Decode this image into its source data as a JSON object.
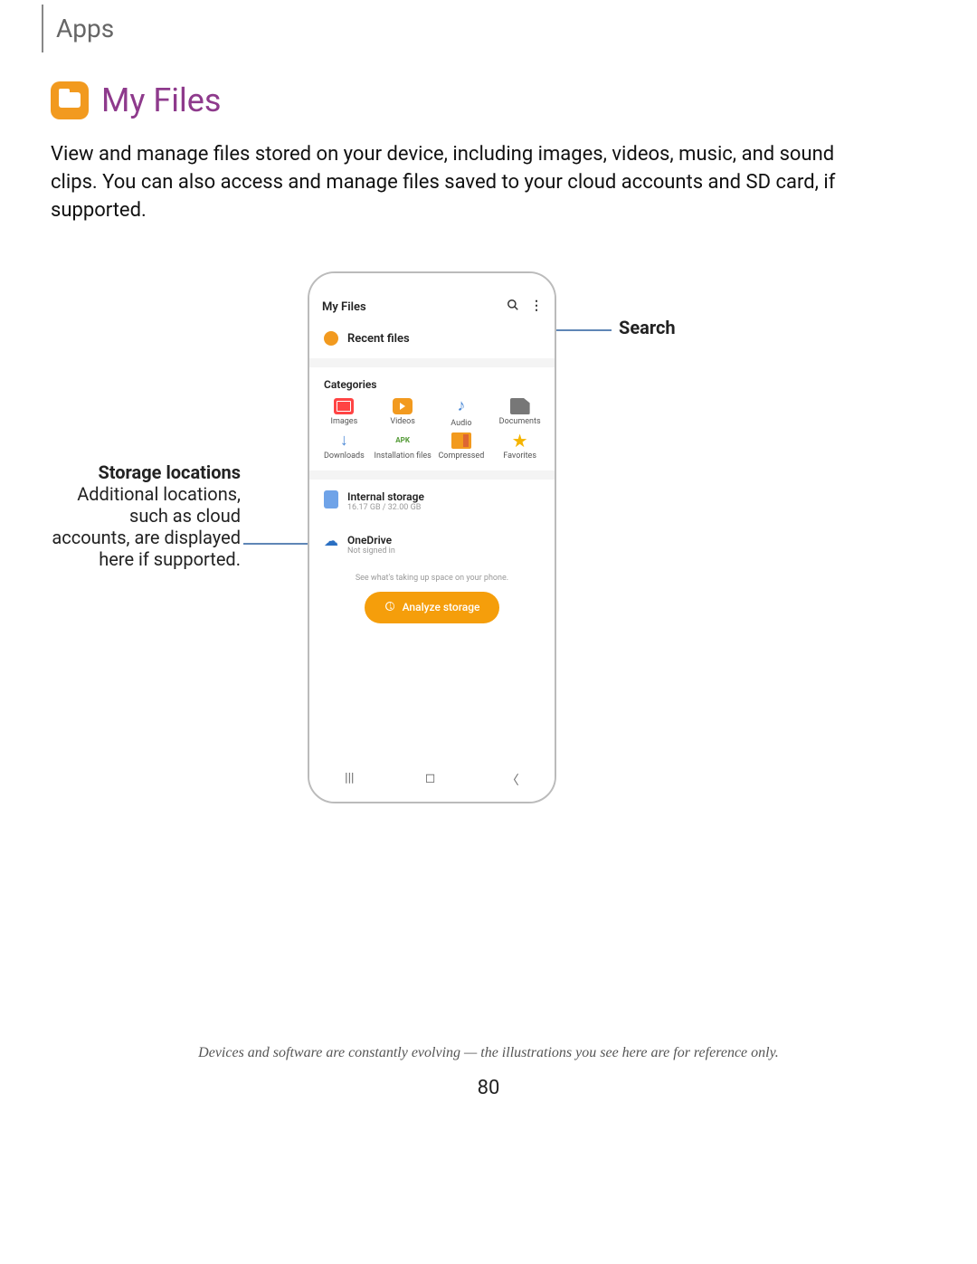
{
  "breadcrumb": "Apps",
  "section": {
    "title": "My Files",
    "description": "View and manage files stored on your device, including images, videos, music, and sound clips. You can also access and manage files saved to your cloud accounts and SD card, if supported."
  },
  "callouts": {
    "search": "Search",
    "storage_title": "Storage locations",
    "storage_body": "Additional locations, such as cloud accounts, are displayed here if supported."
  },
  "phone": {
    "app_title": "My Files",
    "recent": "Recent files",
    "categories_title": "Categories",
    "categories": [
      {
        "label": "Images"
      },
      {
        "label": "Videos"
      },
      {
        "label": "Audio"
      },
      {
        "label": "Documents"
      },
      {
        "label": "Downloads"
      },
      {
        "label": "Installation files"
      },
      {
        "label": "Compressed"
      },
      {
        "label": "Favorites"
      }
    ],
    "storage": [
      {
        "name": "Internal storage",
        "sub": "16.17 GB / 32.00 GB"
      },
      {
        "name": "OneDrive",
        "sub": "Not signed in"
      }
    ],
    "analyze_hint": "See what's taking up space on your phone.",
    "analyze_button": "Analyze storage"
  },
  "footer": "Devices and software are constantly evolving — the illustrations you see here are for reference only.",
  "page_number": "80"
}
